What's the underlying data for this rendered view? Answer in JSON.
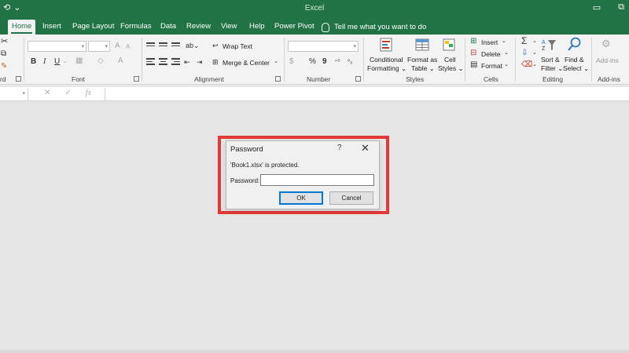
{
  "app": {
    "title": "Excel",
    "qat": [
      "⟲",
      "⌄"
    ],
    "window_buttons": [
      "▭",
      "⧉"
    ]
  },
  "tabs": [
    {
      "label": "Home",
      "active": true
    },
    {
      "label": "Insert"
    },
    {
      "label": "Page Layout"
    },
    {
      "label": "Formulas"
    },
    {
      "label": "Data"
    },
    {
      "label": "Review"
    },
    {
      "label": "View"
    },
    {
      "label": "Help"
    },
    {
      "label": "Power Pivot"
    }
  ],
  "tell_me": "Tell me what you want to do",
  "ribbon": {
    "groups": {
      "clipboard": "rd",
      "font": "Font",
      "alignment": "Alignment",
      "number": "Number",
      "styles": "Styles",
      "cells": "Cells",
      "editing": "Editing",
      "addins": "Add-ins"
    },
    "font_buttons": {
      "bold": "B",
      "italic": "I",
      "underline": "U"
    },
    "alignment": {
      "wrap_text": "Wrap Text",
      "merge_center": "Merge & Center"
    },
    "number": {
      "percent": "%",
      "comma": "9"
    },
    "styles": {
      "conditional_1": "Conditional",
      "conditional_2": "Formatting ⌄",
      "format_table_1": "Format as",
      "format_table_2": "Table ⌄",
      "cell_styles_1": "Cell",
      "cell_styles_2": "Styles ⌄"
    },
    "cells": {
      "insert": "Insert",
      "delete": "Delete",
      "format": "Format"
    },
    "editing": {
      "sort_1": "Sort &",
      "sort_2": "Filter ⌄",
      "find_1": "Find &",
      "find_2": "Select ⌄"
    },
    "addins": {
      "label": "Add-ins"
    }
  },
  "formula_bar": {
    "cancel": "✕",
    "enter": "✓",
    "fx": "fx"
  },
  "dialog": {
    "title": "Password",
    "help": "?",
    "close": "✕",
    "message": "'Book1.xlsx' is protected.",
    "password_label": "Password:",
    "password_value": "",
    "ok": "OK",
    "cancel": "Cancel"
  },
  "colors": {
    "brand": "#217346",
    "highlight": "#e53935",
    "default_button": "#0078d7"
  }
}
